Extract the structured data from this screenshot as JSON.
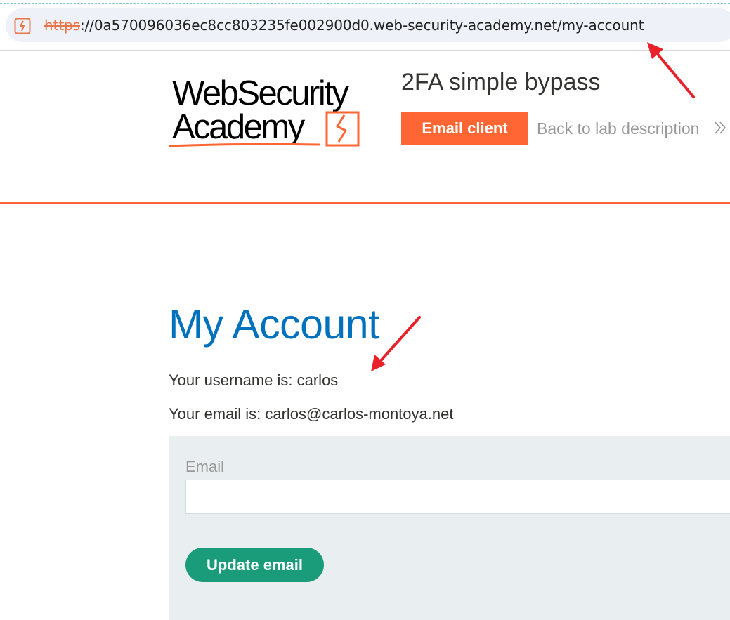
{
  "browser": {
    "url_scheme": "https",
    "url_rest": "://0a570096036ec8cc803235fe002900d0.web-security-academy.net/my-account"
  },
  "header": {
    "logo_line1": "WebSecurity",
    "logo_line2": "Academy",
    "lab_title": "2FA simple bypass",
    "email_client_label": "Email client",
    "back_link_label": "Back to lab description"
  },
  "main": {
    "title": "My Account",
    "username_text": "Your username is: carlos",
    "email_text": "Your email is: carlos@carlos-montoya.net",
    "form": {
      "email_label": "Email",
      "email_value": "",
      "update_button_label": "Update email"
    }
  },
  "colors": {
    "accent": "#ff6633",
    "title_blue": "#0071bc",
    "button_green": "#1a9c7b",
    "annotation_red": "#e8212b"
  },
  "icons": [
    "site-favicon-icon",
    "academy-logo-icon",
    "double-chevron-right-icon",
    "annotation-arrow-icon"
  ]
}
